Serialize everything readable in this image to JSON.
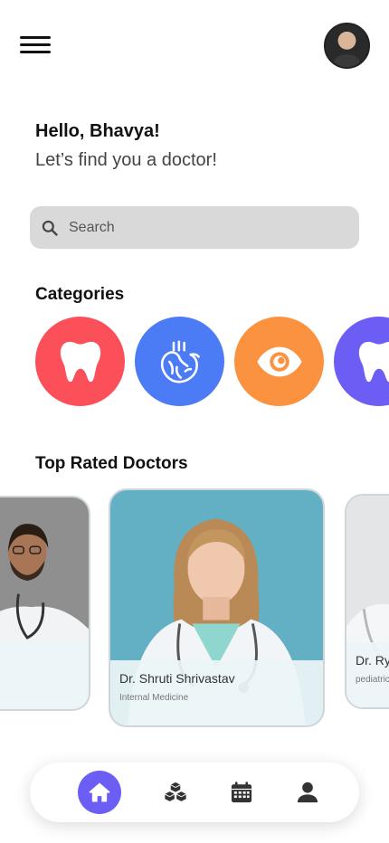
{
  "header": {
    "greeting": "Hello, Bhavya!",
    "subtitle": "Let’s find you a doctor!"
  },
  "search": {
    "placeholder": "Search"
  },
  "categories": {
    "title": "Categories",
    "items": [
      {
        "icon": "tooth-icon",
        "color": "#fb4f5a"
      },
      {
        "icon": "heart-icon",
        "color": "#4b7bf5"
      },
      {
        "icon": "eye-icon",
        "color": "#fb9240"
      },
      {
        "icon": "tooth-icon",
        "color": "#6c5ef5"
      }
    ]
  },
  "doctors": {
    "title": "Top Rated Doctors",
    "items": [
      {
        "name": "",
        "specialty": ""
      },
      {
        "name": "Dr. Shruti Shrivastav",
        "specialty": "Internal Medicine"
      },
      {
        "name": "Dr. Ry",
        "specialty": "pediatric"
      }
    ]
  },
  "nav": {
    "items": [
      {
        "icon": "home-icon",
        "active": true
      },
      {
        "icon": "cubes-icon",
        "active": false
      },
      {
        "icon": "calendar-icon",
        "active": false
      },
      {
        "icon": "profile-icon",
        "active": false
      }
    ]
  },
  "colors": {
    "accent": "#6c5ef5",
    "search_bg": "#d9d9d9"
  }
}
